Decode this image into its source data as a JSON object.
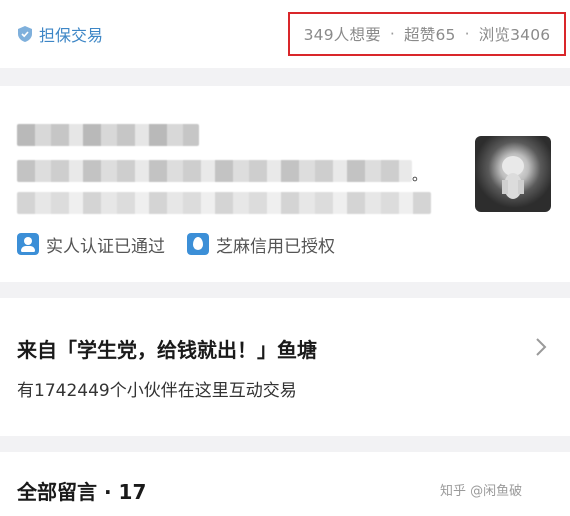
{
  "header": {
    "guarantee_label": "担保交易",
    "stats": {
      "want": "349人想要",
      "likes": "超赞65",
      "views": "浏览3406",
      "separator": "·"
    }
  },
  "seller": {
    "trailing_mark": "。",
    "badges": [
      {
        "icon": "person-verify-icon",
        "label": "实人认证已通过"
      },
      {
        "icon": "sesame-credit-icon",
        "label": "芝麻信用已授权"
      }
    ]
  },
  "pond": {
    "title": "来自「学生党，给钱就出！」鱼塘",
    "subtitle": "有1742449个小伙伴在这里互动交易"
  },
  "comments": {
    "title": "全部留言 · 17"
  },
  "watermark": "知乎 @闲鱼破",
  "colors": {
    "accent_blue": "#3d86c6",
    "highlight_red": "#d9262a",
    "badge_blue": "#3c8fd7"
  }
}
